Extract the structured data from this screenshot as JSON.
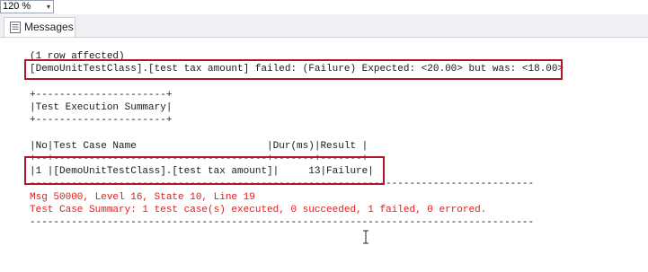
{
  "zoom": {
    "value": "120 %",
    "arrow": "▾"
  },
  "tabs": [
    {
      "label": "Messages"
    }
  ],
  "messages": {
    "rows_affected": "(1 row affected)",
    "failure_line": "[DemoUnitTestClass].[test tax amount] failed: (Failure) Expected: <20.00> but was: <18.00>",
    "summary_border_top": "+----------------------+",
    "summary_title": "|Test Execution Summary|",
    "summary_border_bottom": "+----------------------+",
    "table_header": "|No|Test Case Name                      |Dur(ms)|Result |",
    "table_separator": "+--+------------------------------------+-------+-------+",
    "table_row": "|1 |[DemoUnitTestClass].[test tax amount]|     13|Failure|",
    "long_rule_1": "-------------------------------------------------------------------------------------",
    "error_line": "Msg 50000, Level 16, State 10, Line 19",
    "case_summary": "Test Case Summary: 1 test case(s) executed, 0 succeeded, 1 failed, 0 errored.",
    "long_rule_2": "-------------------------------------------------------------------------------------"
  },
  "colors": {
    "error_text": "#e21b1b",
    "highlight_border": "#b0152a"
  }
}
